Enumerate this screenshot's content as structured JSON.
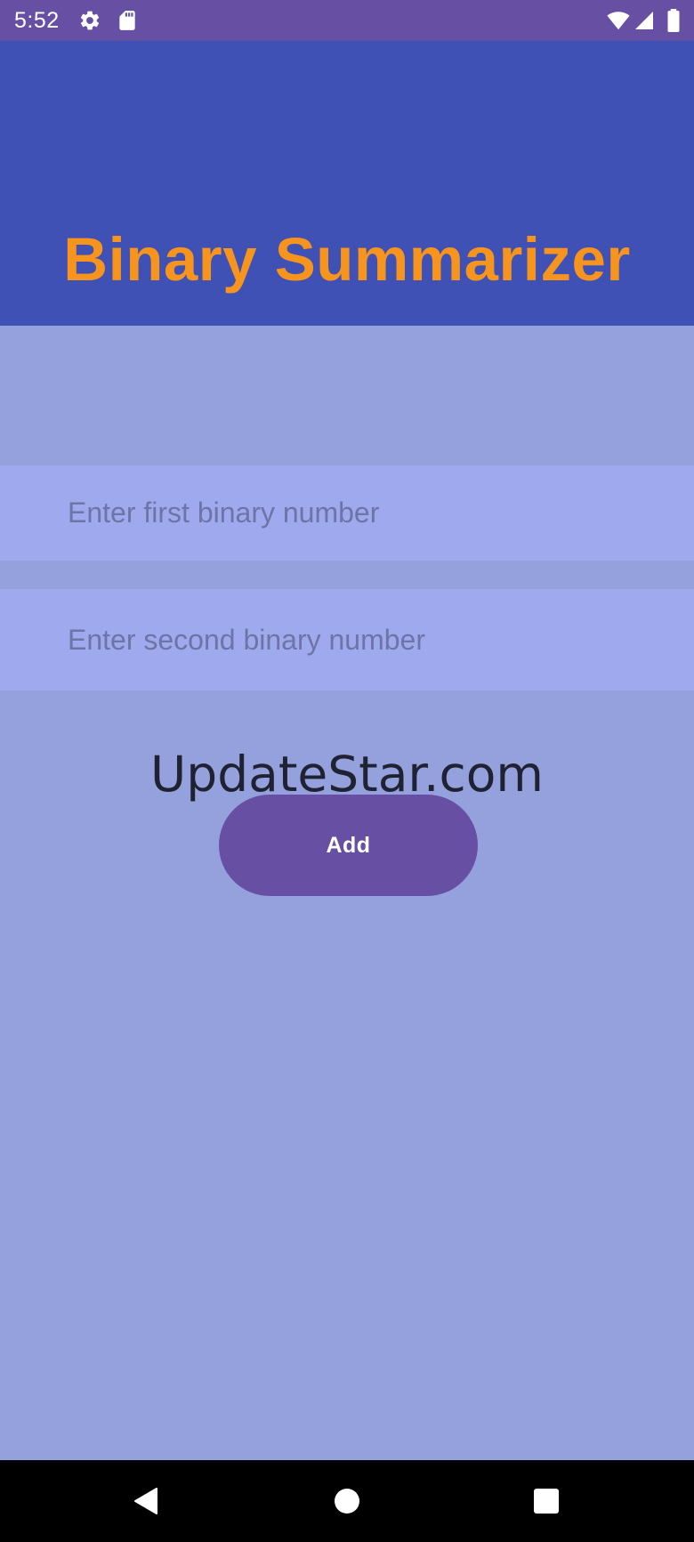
{
  "status_bar": {
    "time": "5:52",
    "background": "#6750a4",
    "icons": [
      "gear-icon",
      "sd-card-icon",
      "wifi-icon",
      "signal-icon",
      "battery-icon"
    ]
  },
  "header": {
    "title": "Binary Summarizer",
    "background": "#3f51b5",
    "title_color": "#f7941d"
  },
  "form": {
    "first_input": {
      "placeholder": "Enter first binary number",
      "value": ""
    },
    "second_input": {
      "placeholder": "Enter second binary number",
      "value": ""
    },
    "add_label": "Add",
    "button_color": "#6750a4"
  },
  "watermark": "UpdateStar.com",
  "colors": {
    "page_background": "#95a1dc",
    "input_background": "#9faaee"
  },
  "nav_bar": {
    "icons": [
      "back-icon",
      "home-icon",
      "recents-icon"
    ]
  }
}
